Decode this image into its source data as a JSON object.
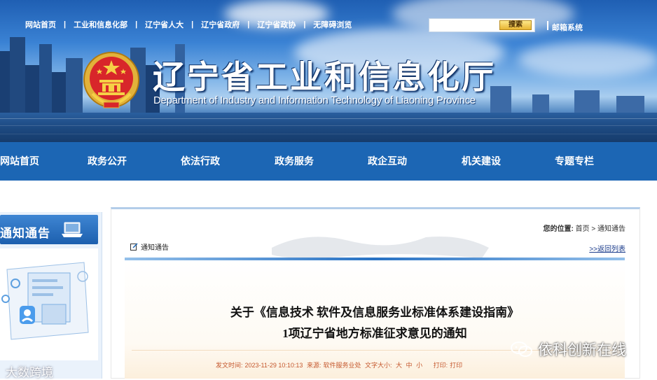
{
  "top_links": [
    "网站首页",
    "工业和信息化部",
    "辽宁省人大",
    "辽宁省政府",
    "辽宁省政协",
    "无障碍浏览"
  ],
  "search": {
    "button_label": "搜索",
    "placeholder": ""
  },
  "mail_link": "邮箱系统",
  "site": {
    "title": "辽宁省工业和信息化厅",
    "subtitle": "Department of Industry and Information Technology of Liaoning Province"
  },
  "nav": [
    "网站首页",
    "政务公开",
    "依法行政",
    "政务服务",
    "政企互动",
    "机关建设",
    "专题专栏"
  ],
  "sidebar": {
    "heading": "通知通告"
  },
  "breadcrumb": {
    "prefix": "您的位置:",
    "home": "首页",
    "separator": " > ",
    "current": "通知通告"
  },
  "section": {
    "label": "通知通告",
    "return_link": ">>返回列表"
  },
  "article": {
    "title_line1": "关于《信息技术 软件及信息服务业标准体系建设指南》",
    "title_line2": "1项辽宁省地方标准征求意见的通知",
    "meta": {
      "published_label": "发文时间:",
      "published": "2023-11-29 10:10:13",
      "source_label": "来源:",
      "source": "软件服务业处",
      "size_label": "文字大小:",
      "sizes": [
        "大",
        "中",
        "小"
      ],
      "print_label": "打印:",
      "print": "打印"
    }
  },
  "watermarks": {
    "left": "大数跨境",
    "right": "依科创新在线"
  },
  "colors": {
    "nav_bg": "#1c66b4",
    "accent": "#2872c4",
    "meta_text": "#c5582e"
  }
}
